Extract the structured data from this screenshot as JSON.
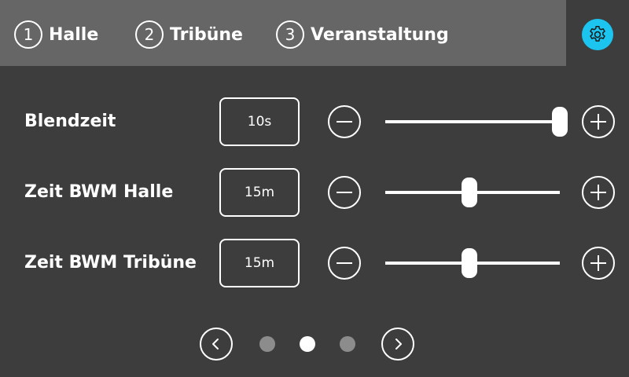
{
  "header": {
    "tabs": [
      {
        "number": "1",
        "label": "Halle"
      },
      {
        "number": "2",
        "label": "Tribüne"
      },
      {
        "number": "3",
        "label": "Veranstaltung"
      }
    ],
    "settings_icon": "gear-icon"
  },
  "settings": [
    {
      "label": "Blendzeit",
      "value": "10s",
      "slider_level": 1.0
    },
    {
      "label": "Zeit BWM Halle",
      "value": "15m",
      "slider_level": 0.48
    },
    {
      "label": "Zeit BWM Tribüne",
      "value": "15m",
      "slider_level": 0.48
    }
  ],
  "pagination": {
    "page_count": 3,
    "current_page": 2
  },
  "colors": {
    "background": "#3d3d3d",
    "header_bar": "#666666",
    "accent": "#1cc5ef",
    "dot_inactive": "#8c8c8c",
    "dot_active": "#ffffff"
  }
}
